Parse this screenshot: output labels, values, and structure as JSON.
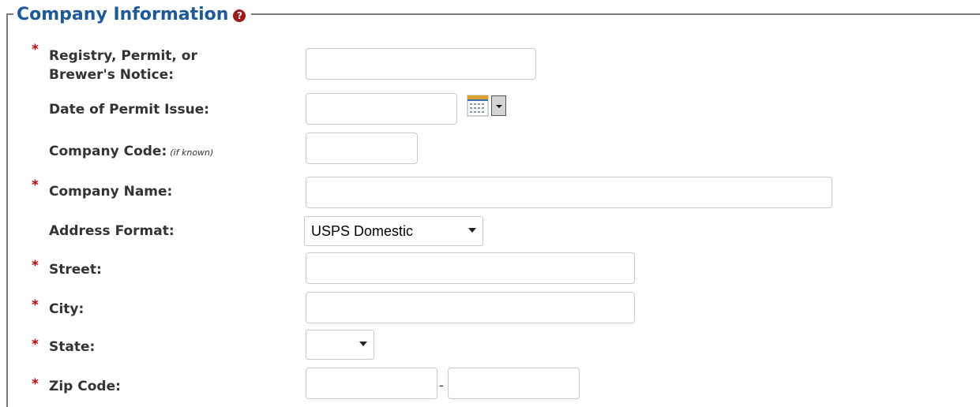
{
  "section": {
    "title": "Company Information",
    "help_glyph": "?",
    "title_color": "#1d5a9a"
  },
  "fields": {
    "registry": {
      "required_mark": "*",
      "label_line1": "Registry, Permit, or",
      "label_line2": "Brewer's Notice:",
      "value": ""
    },
    "permit_date": {
      "label": "Date of Permit Issue:",
      "value": ""
    },
    "company_code": {
      "label": "Company Code:",
      "hint": "(if known)",
      "value": ""
    },
    "company_name": {
      "required_mark": "*",
      "label": "Company Name:",
      "value": ""
    },
    "address_format": {
      "label": "Address Format:",
      "selected": "USPS Domestic"
    },
    "street": {
      "required_mark": "*",
      "label": "Street:",
      "value": ""
    },
    "city": {
      "required_mark": "*",
      "label": "City:",
      "value": ""
    },
    "state": {
      "required_mark": "*",
      "label": "State:",
      "selected": ""
    },
    "zip": {
      "required_mark": "*",
      "label": "Zip Code:",
      "separator": "-",
      "value": "",
      "ext_value": ""
    }
  },
  "icons": {
    "help": "help-icon",
    "calendar": "calendar-icon",
    "dropdown": "chevron-down-icon"
  },
  "colors": {
    "required": "#cc0000",
    "help_icon_bg": "#a01818"
  }
}
